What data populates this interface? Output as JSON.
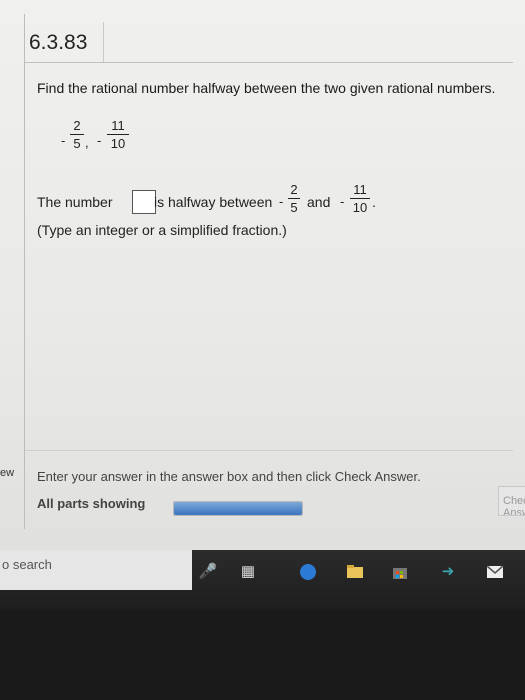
{
  "problem": {
    "number": "6.3.83",
    "instruction": "Find the rational number halfway between the two given rational numbers.",
    "given": {
      "a": {
        "sign": "-",
        "numerator": "2",
        "denominator": "5"
      },
      "separator": ",",
      "b": {
        "sign": "-",
        "numerator": "11",
        "denominator": "10"
      }
    },
    "sentence": {
      "prefix": "The number",
      "middle": "is halfway between",
      "conj": "and",
      "end": "."
    },
    "answer_value": "",
    "type_hint": "(Type an integer or a simplified fraction.)"
  },
  "footer": {
    "status": "Enter your answer in the answer box and then click Check Answer.",
    "parts_label": "All parts showing",
    "progress": 1.0,
    "check_button": "Check Answer",
    "left_edge_text": "ew"
  },
  "taskbar": {
    "search_placeholder": "o search",
    "icons": [
      "microphone-icon",
      "task-view-icon",
      "edge-icon",
      "file-explorer-icon",
      "store-icon",
      "sway-icon",
      "mail-icon"
    ]
  }
}
